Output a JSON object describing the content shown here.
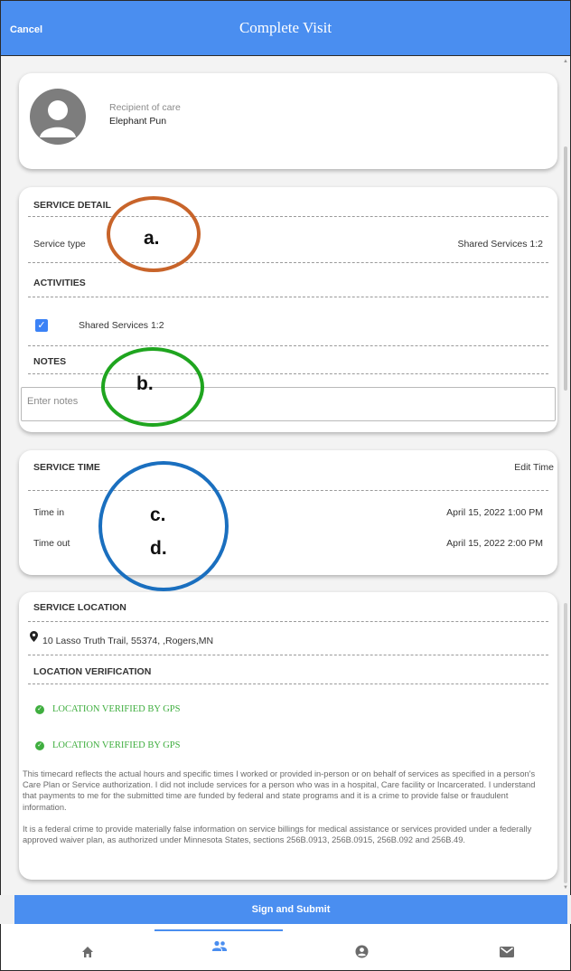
{
  "header": {
    "cancel_label": "Cancel",
    "title": "Complete Visit"
  },
  "recipient": {
    "label": "Recipient of care",
    "name": "Elephant Pun"
  },
  "service_detail": {
    "heading": "SERVICE DETAIL",
    "service_type_label": "Service type",
    "service_type_value": "Shared Services 1:2",
    "activities_heading": "ACTIVITIES",
    "activity_label": "Shared Services 1:2",
    "activity_checked": true,
    "notes_heading": "NOTES",
    "notes_placeholder": "Enter notes",
    "notes_value": ""
  },
  "service_time": {
    "heading": "SERVICE TIME",
    "edit_label": "Edit Time",
    "time_in_label": "Time in",
    "time_in_value": "April 15, 2022 1:00 PM",
    "time_out_label": "Time out",
    "time_out_value": "April 15, 2022 2:00 PM"
  },
  "service_location": {
    "heading": "SERVICE LOCATION",
    "address": "10 Lasso Truth Trail, 55374, ,Rogers,MN",
    "verification_heading": "LOCATION VERIFICATION",
    "verified_1": "LOCATION VERIFIED BY GPS",
    "verified_2": "LOCATION VERIFIED BY GPS",
    "status_color": "#3fae3f"
  },
  "legal": {
    "paragraph_1": "This timecard reflects the actual hours and specific times I worked or provided in-person or on behalf of services as specified in a person's Care Plan or Service authorization. I did not include services for a person who was in a hospital, Care facility or Incarcerated. I understand that payments to me for the submitted time are funded by federal and state programs and it is a crime to provide false or fraudulent information.",
    "paragraph_2": "It is a federal crime to provide materially false information on service billings for medical assistance or services provided under a federally approved waiver plan, as authorized under Minnesota States, sections 256B.0913, 256B.0915, 256B.092 and 256B.49."
  },
  "annotations": [
    {
      "label": "a.",
      "color": "#c8642a"
    },
    {
      "label": "b.",
      "color": "#1fa51f"
    },
    {
      "label": "c.",
      "color": "#1a6fbf"
    },
    {
      "label": "d.",
      "color": ""
    }
  ],
  "submit_label": "Sign and Submit",
  "tabs": [
    {
      "icon": "home-icon"
    },
    {
      "icon": "people-icon",
      "active": true
    },
    {
      "icon": "account-circle-icon"
    },
    {
      "icon": "mail-icon"
    }
  ],
  "colors": {
    "primary": "#4a8ef0",
    "checkbox": "#3b82f6"
  }
}
